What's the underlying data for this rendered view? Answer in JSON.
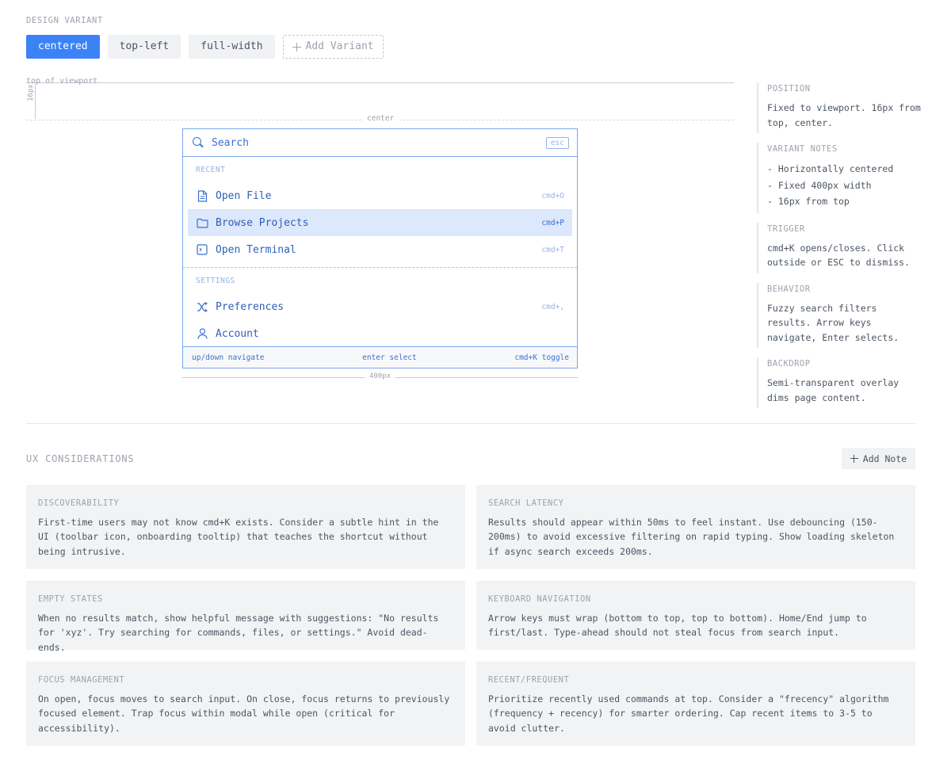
{
  "design_variant": {
    "label": "DESIGN VARIANT",
    "tabs": [
      {
        "label": "centered",
        "active": true
      },
      {
        "label": "top-left",
        "active": false
      },
      {
        "label": "full-width",
        "active": false
      }
    ],
    "add_label": "Add Variant"
  },
  "canvas": {
    "viewport_label": "top of viewport",
    "gap_label": "16px",
    "center_label": "center",
    "width_label": "400px"
  },
  "palette": {
    "search_placeholder": "Search",
    "esc_label": "esc",
    "groups": [
      {
        "label": "RECENT",
        "items": [
          {
            "label": "Open File",
            "shortcut": "cmd+O",
            "icon": "file-icon"
          },
          {
            "label": "Browse Projects",
            "shortcut": "cmd+P",
            "icon": "folder-icon",
            "selected": true
          },
          {
            "label": "Open Terminal",
            "shortcut": "cmd+T",
            "icon": "terminal-icon"
          }
        ]
      },
      {
        "label": "SETTINGS",
        "items": [
          {
            "label": "Preferences",
            "shortcut": "cmd+,",
            "icon": "shuffle-icon"
          },
          {
            "label": "Account",
            "shortcut": "",
            "icon": "user-icon"
          }
        ]
      }
    ],
    "footer": {
      "navigate": "up/down navigate",
      "select": "enter select",
      "toggle": "cmd+K toggle"
    }
  },
  "notes": {
    "position": {
      "title": "POSITION",
      "body": "Fixed to viewport. 16px from top, center."
    },
    "variant_notes": {
      "title": "VARIANT NOTES",
      "items": [
        "- Horizontally centered",
        "- Fixed 400px width",
        "- 16px from top"
      ]
    },
    "trigger": {
      "title": "TRIGGER",
      "body": "cmd+K opens/closes. Click outside or ESC to dismiss."
    },
    "behavior": {
      "title": "BEHAVIOR",
      "body": "Fuzzy search filters results. Arrow keys navigate, Enter selects."
    },
    "backdrop": {
      "title": "BACKDROP",
      "body": "Semi-transparent overlay dims page content."
    }
  },
  "ux": {
    "title": "UX CONSIDERATIONS",
    "add_note_label": "Add Note",
    "cards": [
      {
        "title": "DISCOVERABILITY",
        "body": "First-time users may not know cmd+K exists. Consider a subtle hint in the UI (toolbar icon, onboarding tooltip) that teaches the shortcut without being intrusive."
      },
      {
        "title": "SEARCH LATENCY",
        "body": "Results should appear within 50ms to feel instant. Use debouncing (150-200ms) to avoid excessive filtering on rapid typing. Show loading skeleton if async search exceeds 200ms."
      },
      {
        "title": "EMPTY STATES",
        "body": "When no results match, show helpful message with suggestions: \"No results for 'xyz'. Try searching for commands, files, or settings.\" Avoid dead-ends."
      },
      {
        "title": "KEYBOARD NAVIGATION",
        "body": "Arrow keys must wrap (bottom to top, top to bottom). Home/End jump to first/last. Type-ahead should not steal focus from search input."
      },
      {
        "title": "FOCUS MANAGEMENT",
        "body": "On open, focus moves to search input. On close, focus returns to previously focused element. Trap focus within modal while open (critical for accessibility)."
      },
      {
        "title": "RECENT/FREQUENT",
        "body": "Prioritize recently used commands at top. Consider a \"frecency\" algorithm (frequency + recency) for smarter ordering. Cap recent items to 3-5 to avoid clutter."
      }
    ]
  },
  "colors": {
    "accent": "#3b82f6",
    "palette_border": "#7aa7ec",
    "selected_row": "#dce8fb",
    "card_bg": "#f2f3f5"
  }
}
